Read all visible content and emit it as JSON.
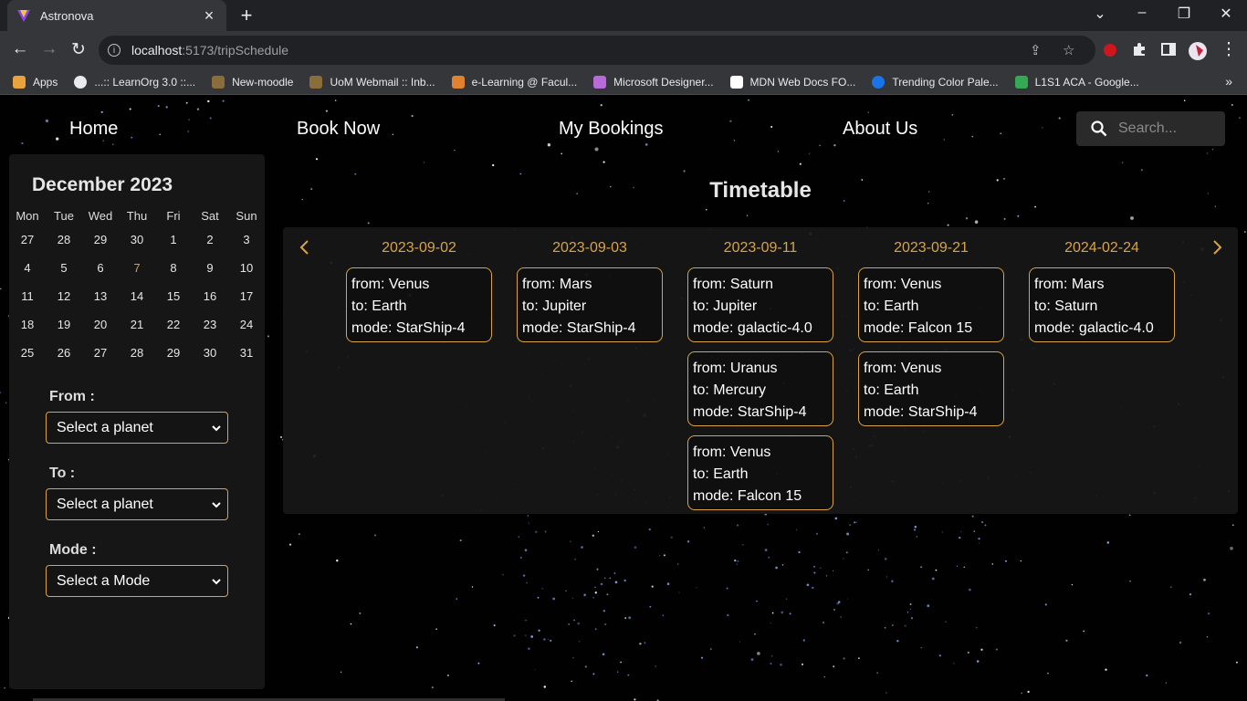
{
  "browser": {
    "tab_title": "Astronova",
    "url_host": "localhost",
    "url_rest": ":5173/tripSchedule",
    "bookmarks": [
      {
        "label": "Apps",
        "icon": "apps-grid-icon",
        "color": "#e8a33d"
      },
      {
        "label": "...:: LearnOrg 3.0 ::...",
        "icon": "globe-icon",
        "color": "#e8eaed"
      },
      {
        "label": "New-moodle",
        "icon": "moodle-icon",
        "color": "#8a6d3b"
      },
      {
        "label": "UoM Webmail :: Inb...",
        "icon": "uom-icon",
        "color": "#8a6d3b"
      },
      {
        "label": "e-Learning @ Facul...",
        "icon": "elearning-icon",
        "color": "#e0822f"
      },
      {
        "label": "Microsoft Designer...",
        "icon": "designer-icon",
        "color": "#b66bd8"
      },
      {
        "label": "MDN Web Docs FO...",
        "icon": "mdn-icon",
        "color": "#ffffff"
      },
      {
        "label": "Trending Color Pale...",
        "icon": "coolors-icon",
        "color": "#1a73e8"
      },
      {
        "label": "L1S1 ACA - Google...",
        "icon": "drive-icon",
        "color": "#34a853"
      }
    ]
  },
  "nav": {
    "home": "Home",
    "book_now": "Book Now",
    "my_bookings": "My Bookings",
    "about_us": "About Us",
    "search_placeholder": "Search..."
  },
  "calendar": {
    "title": "December 2023",
    "weekdays": [
      "Mon",
      "Tue",
      "Wed",
      "Thu",
      "Fri",
      "Sat",
      "Sun"
    ],
    "weeks": [
      [
        "27",
        "28",
        "29",
        "30",
        "1",
        "2",
        "3"
      ],
      [
        "4",
        "5",
        "6",
        "7",
        "8",
        "9",
        "10"
      ],
      [
        "11",
        "12",
        "13",
        "14",
        "15",
        "16",
        "17"
      ],
      [
        "18",
        "19",
        "20",
        "21",
        "22",
        "23",
        "24"
      ],
      [
        "25",
        "26",
        "27",
        "28",
        "29",
        "30",
        "31"
      ]
    ],
    "highlighted_day": "7",
    "highlight_color": "#d9a441"
  },
  "filters": {
    "from_label": "From :",
    "from_value": "Select a planet",
    "to_label": "To :",
    "to_value": "Select a planet",
    "mode_label": "Mode :",
    "mode_value": "Select a Mode"
  },
  "timetable": {
    "title": "Timetable",
    "accent_color": "#d9a441",
    "columns": [
      {
        "date": "2023-09-02",
        "trips": [
          {
            "from": "from: Venus",
            "to": "to: Earth",
            "mode": "mode: StarShip-4"
          }
        ]
      },
      {
        "date": "2023-09-03",
        "trips": [
          {
            "from": "from: Mars",
            "to": "to: Jupiter",
            "mode": "mode: StarShip-4"
          }
        ]
      },
      {
        "date": "2023-09-11",
        "trips": [
          {
            "from": "from: Saturn",
            "to": "to: Jupiter",
            "mode": "mode: galactic-4.0"
          },
          {
            "from": "from: Uranus",
            "to": "to: Mercury",
            "mode": "mode: StarShip-4"
          },
          {
            "from": "from: Venus",
            "to": "to: Earth",
            "mode": "mode: Falcon 15"
          }
        ]
      },
      {
        "date": "2023-09-21",
        "trips": [
          {
            "from": "from: Venus",
            "to": "to: Earth",
            "mode": "mode: Falcon 15"
          },
          {
            "from": "from: Venus",
            "to": "to: Earth",
            "mode": "mode: StarShip-4"
          }
        ]
      },
      {
        "date": "2024-02-24",
        "trips": [
          {
            "from": "from: Mars",
            "to": "to: Saturn",
            "mode": "mode: galactic-4.0"
          }
        ]
      }
    ]
  }
}
